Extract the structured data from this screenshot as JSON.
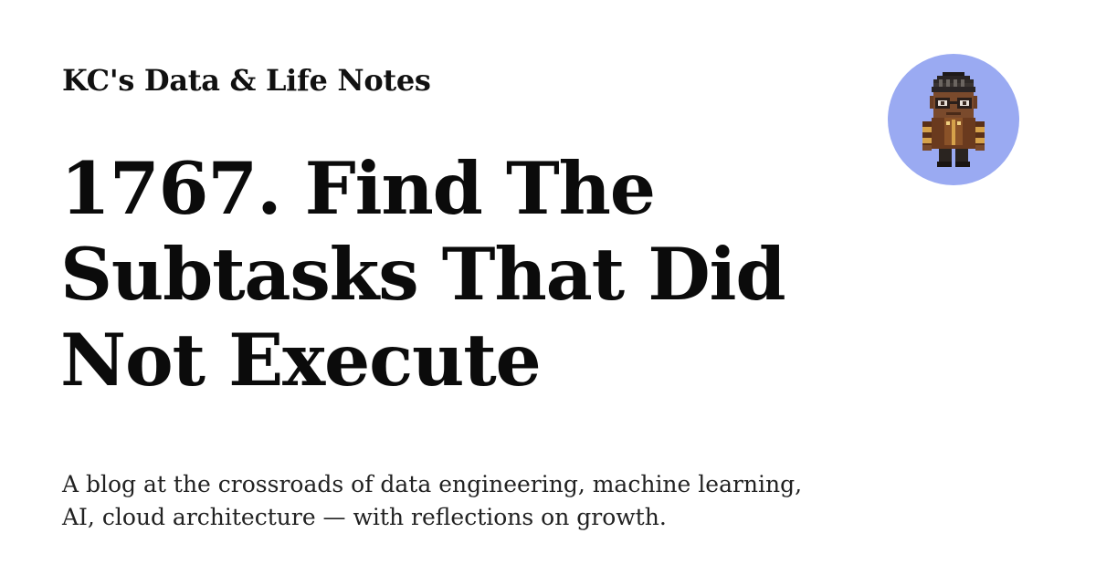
{
  "site": {
    "name": "KC's Data & Life Notes"
  },
  "post": {
    "title": "1767. Find The Subtasks That Did Not Execute"
  },
  "blog": {
    "tagline": "A blog at the crossroads of data engineering, machine learning, AI, cloud architecture — with reflections on growth."
  },
  "avatar": {
    "icon": "pixel-art-character-avatar-icon",
    "background_color": "#9aaaf2"
  },
  "colors": {
    "text": "#111111",
    "background": "#ffffff"
  }
}
